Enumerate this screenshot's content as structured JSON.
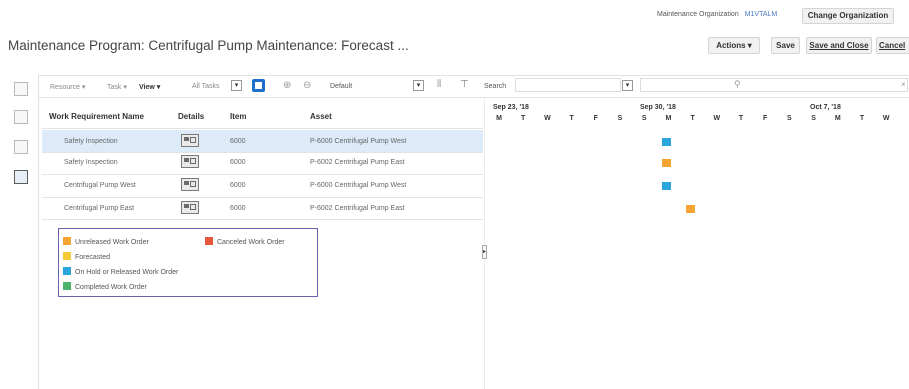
{
  "header": {
    "org_label": "Maintenance Organization",
    "org_code": "M1VTALM",
    "change_org": "Change Organization",
    "title": "Maintenance Program: Centrifugal Pump Maintenance: Forecast ...",
    "actions": "Actions ▾",
    "save": "Save",
    "save_close": "Save and Close",
    "cancel": "Cancel"
  },
  "toolbar": {
    "resource": "Resource ▾",
    "task": "Task ▾",
    "view": "View ▾",
    "all_tasks": "All Tasks",
    "default": "Default",
    "search": "Search"
  },
  "columns": [
    "Work Requirement Name",
    "Details",
    "Item",
    "Asset"
  ],
  "rows": [
    {
      "name": "Safety Inspection",
      "item": "6000",
      "asset": "P-6000 Centrifugal Pump West",
      "selected": true
    },
    {
      "name": "Safety Inspection",
      "item": "6000",
      "asset": "P-6002 Centrifugal Pump East",
      "selected": false
    },
    {
      "name": "Centrifugal Pump West",
      "item": "6000",
      "asset": "P-6000 Centrifugal Pump West",
      "selected": false
    },
    {
      "name": "Centrifugal Pump East",
      "item": "6000",
      "asset": "P-6002 Centrifugal Pump East",
      "selected": false
    }
  ],
  "gantt": {
    "weeks": [
      "Sep 23, '18",
      "Sep 30, '18",
      "Oct 7, '18"
    ],
    "days": [
      "M",
      "T",
      "W",
      "T",
      "F",
      "S",
      "S",
      "M",
      "T",
      "W",
      "T",
      "F",
      "S",
      "S",
      "M",
      "T",
      "W"
    ]
  },
  "legend": {
    "unreleased": "Unreleased Work Order",
    "canceled": "Canceled Work Order",
    "forecasted": "Forecasted",
    "onhold": "On Hold or Released Work Order",
    "completed": "Completed Work Order"
  },
  "colors": {
    "unreleased": "#f4a533",
    "canceled": "#e9583a",
    "forecasted": "#f6c938",
    "onhold": "#2aa6dc",
    "completed": "#4cb46a",
    "selected_row": "#dcebf7"
  }
}
